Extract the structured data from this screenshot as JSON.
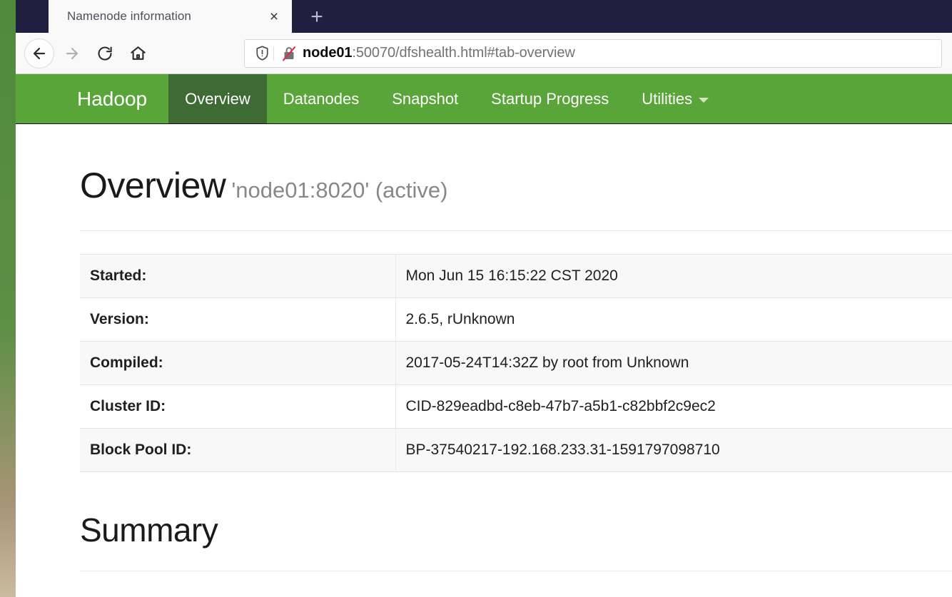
{
  "browser": {
    "tab": {
      "title": "Namenode information",
      "close_label": "×"
    },
    "new_tab_label": "+",
    "toolbar": {
      "back_name": "back-arrow-icon",
      "forward_name": "forward-arrow-icon",
      "reload_name": "reload-icon",
      "home_name": "home-icon"
    },
    "urlbar": {
      "shield_icon": "shield-icon",
      "lock_icon": "crossed-out-lock-icon",
      "host": "node01",
      "path": ":50070/dfshealth.html#tab-overview",
      "full_url": "node01:50070/dfshealth.html#tab-overview"
    }
  },
  "navbar": {
    "brand": "Hadoop",
    "items": [
      {
        "label": "Overview",
        "active": true
      },
      {
        "label": "Datanodes",
        "active": false
      },
      {
        "label": "Snapshot",
        "active": false
      },
      {
        "label": "Startup Progress",
        "active": false
      },
      {
        "label": "Utilities",
        "active": false,
        "has_caret": true
      }
    ],
    "background_color": "#5aa53a",
    "active_color": "#3e6b33"
  },
  "overview": {
    "heading": "Overview",
    "subtitle": "'node01:8020' (active)",
    "rows": [
      {
        "key": "Started:",
        "value": "Mon Jun 15 16:15:22 CST 2020"
      },
      {
        "key": "Version:",
        "value": "2.6.5, rUnknown"
      },
      {
        "key": "Compiled:",
        "value": "2017-05-24T14:32Z by root from Unknown"
      },
      {
        "key": "Cluster ID:",
        "value": "CID-829eadbd-c8eb-47b7-a5b1-c82bbf2c9ec2"
      },
      {
        "key": "Block Pool ID:",
        "value": "BP-37540217-192.168.233.31-1591797098710"
      }
    ]
  },
  "summary": {
    "heading": "Summary"
  }
}
